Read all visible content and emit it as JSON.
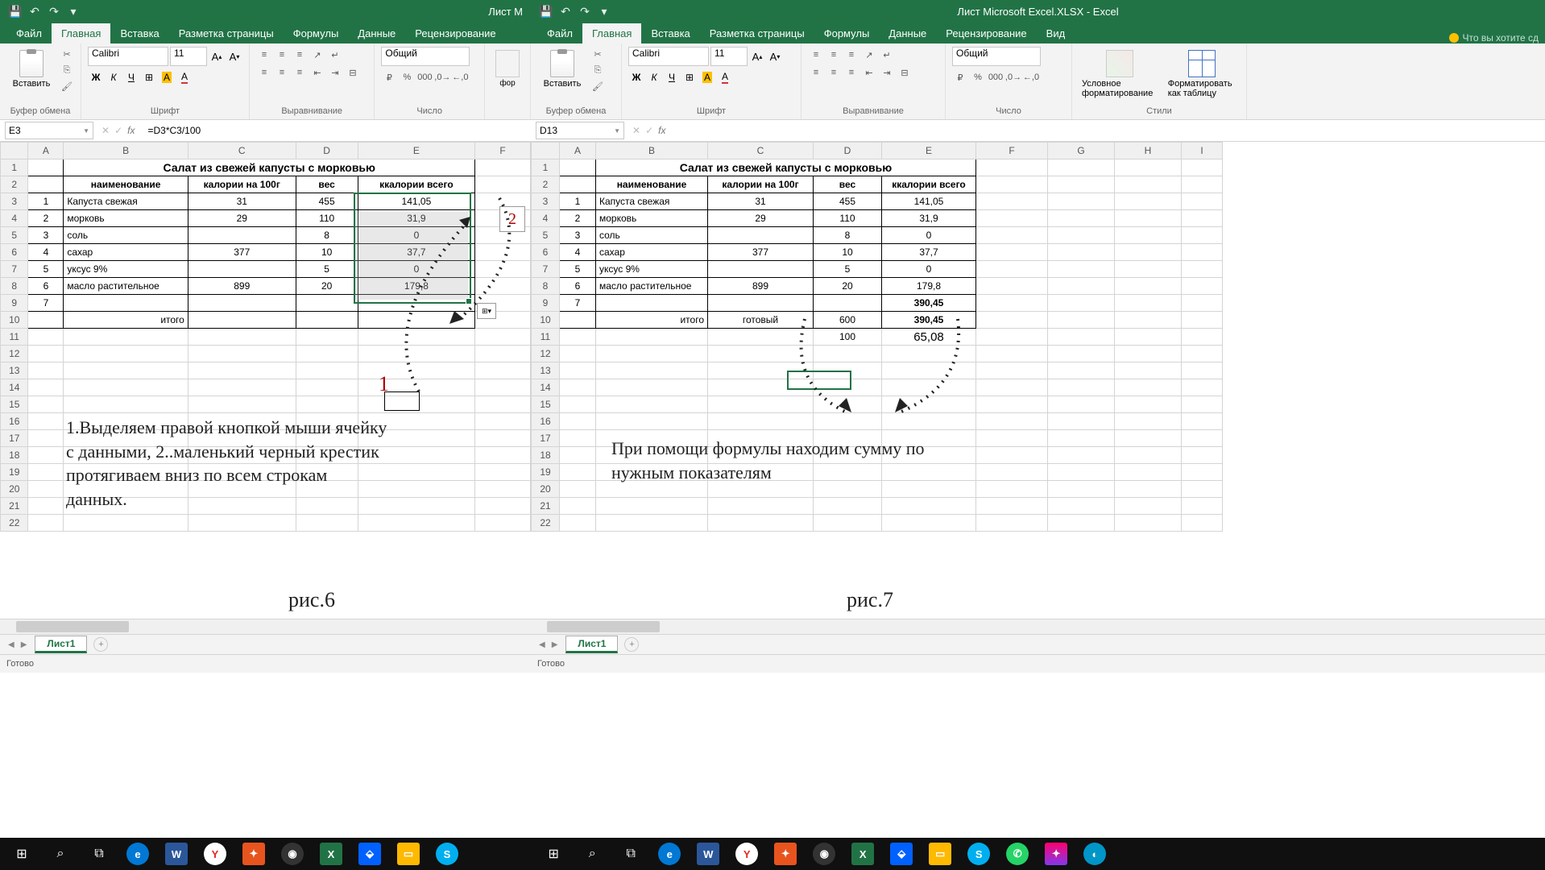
{
  "left": {
    "title": "Лист M",
    "tabs": {
      "file": "Файл",
      "home": "Главная",
      "insert": "Вставка",
      "layout": "Разметка страницы",
      "formulas": "Формулы",
      "data": "Данные",
      "review": "Рецензирование"
    },
    "ribbon": {
      "paste": "Вставить",
      "clipboard": "Буфер обмена",
      "font": "Шрифт",
      "font_name": "Calibri",
      "font_size": "11",
      "align": "Выравнивание",
      "number": "Число",
      "num_fmt": "Общий"
    },
    "name_box": "E3",
    "formula": "=D3*C3/100",
    "cols": [
      "A",
      "B",
      "C",
      "D",
      "E",
      "F"
    ],
    "rows": 22,
    "title_cell": "Салат из свежей капусты с морковью",
    "headers": {
      "b": "наименование",
      "c": "калории на 100г",
      "d": "вес",
      "e": "ккалории всего"
    },
    "data": [
      {
        "n": "1",
        "name": "Капуста свежая",
        "cal": "31",
        "w": "455",
        "kk": "141,05"
      },
      {
        "n": "2",
        "name": "морковь",
        "cal": "29",
        "w": "110",
        "kk": "31,9"
      },
      {
        "n": "3",
        "name": "соль",
        "cal": "",
        "w": "8",
        "kk": "0"
      },
      {
        "n": "4",
        "name": "сахар",
        "cal": "377",
        "w": "10",
        "kk": "37,7"
      },
      {
        "n": "5",
        "name": "уксус 9%",
        "cal": "",
        "w": "5",
        "kk": "0"
      },
      {
        "n": "6",
        "name": "масло растительное",
        "cal": "899",
        "w": "20",
        "kk": "179,8"
      },
      {
        "n": "7",
        "name": "",
        "cal": "",
        "w": "",
        "kk": ""
      }
    ],
    "itogo": "итого",
    "marker1": "1",
    "marker2": "2",
    "annotation": "1.Выделяем правой кнопкой мыши ячейку с данными, 2..маленький черный крестик протягиваем вниз по всем строкам данных.",
    "fig": "рис.6",
    "sheet_tab": "Лист1",
    "status": "Готово"
  },
  "right": {
    "title": "Лист Microsoft Excel.XLSX - Excel",
    "tabs": {
      "file": "Файл",
      "home": "Главная",
      "insert": "Вставка",
      "layout": "Разметка страницы",
      "formulas": "Формулы",
      "data": "Данные",
      "review": "Рецензирование",
      "view": "Вид",
      "tell": "Что вы хотите сд"
    },
    "ribbon": {
      "paste": "Вставить",
      "clipboard": "Буфер обмена",
      "font": "Шрифт",
      "font_name": "Calibri",
      "font_size": "11",
      "align": "Выравнивание",
      "number": "Число",
      "num_fmt": "Общий",
      "styles": "Стили",
      "cond": "Условное форматирование",
      "table": "Форматировать как таблицу"
    },
    "name_box": "D13",
    "formula": "",
    "cols": [
      "A",
      "B",
      "C",
      "D",
      "E",
      "F",
      "G",
      "H",
      "I"
    ],
    "rows": 22,
    "title_cell": "Салат из свежей капусты с морковью",
    "headers": {
      "b": "наименование",
      "c": "калории на 100г",
      "d": "вес",
      "e": "ккалории всего"
    },
    "data": [
      {
        "n": "1",
        "name": "Капуста свежая",
        "cal": "31",
        "w": "455",
        "kk": "141,05"
      },
      {
        "n": "2",
        "name": "морковь",
        "cal": "29",
        "w": "110",
        "kk": "31,9"
      },
      {
        "n": "3",
        "name": "соль",
        "cal": "",
        "w": "8",
        "kk": "0"
      },
      {
        "n": "4",
        "name": "сахар",
        "cal": "377",
        "w": "10",
        "kk": "37,7"
      },
      {
        "n": "5",
        "name": "уксус 9%",
        "cal": "",
        "w": "5",
        "kk": "0"
      },
      {
        "n": "6",
        "name": "масло растительное",
        "cal": "899",
        "w": "20",
        "kk": "179,8"
      },
      {
        "n": "7",
        "name": "",
        "cal": "",
        "w": "",
        "kk": "390,45"
      }
    ],
    "row10": {
      "b": "итого",
      "c": "готовый",
      "d": "600",
      "e": "390,45"
    },
    "row11": {
      "d": "100",
      "e": "65,08"
    },
    "annotation": "При помощи формулы находим сумму по нужным показателям",
    "fig": "рис.7",
    "sheet_tab": "Лист1",
    "status": "Готово"
  },
  "taskbar": {
    "word": "W",
    "excel": "X",
    "yandex": "Y",
    "dropbox": "⧈",
    "folder": "📁",
    "skype": "S"
  }
}
